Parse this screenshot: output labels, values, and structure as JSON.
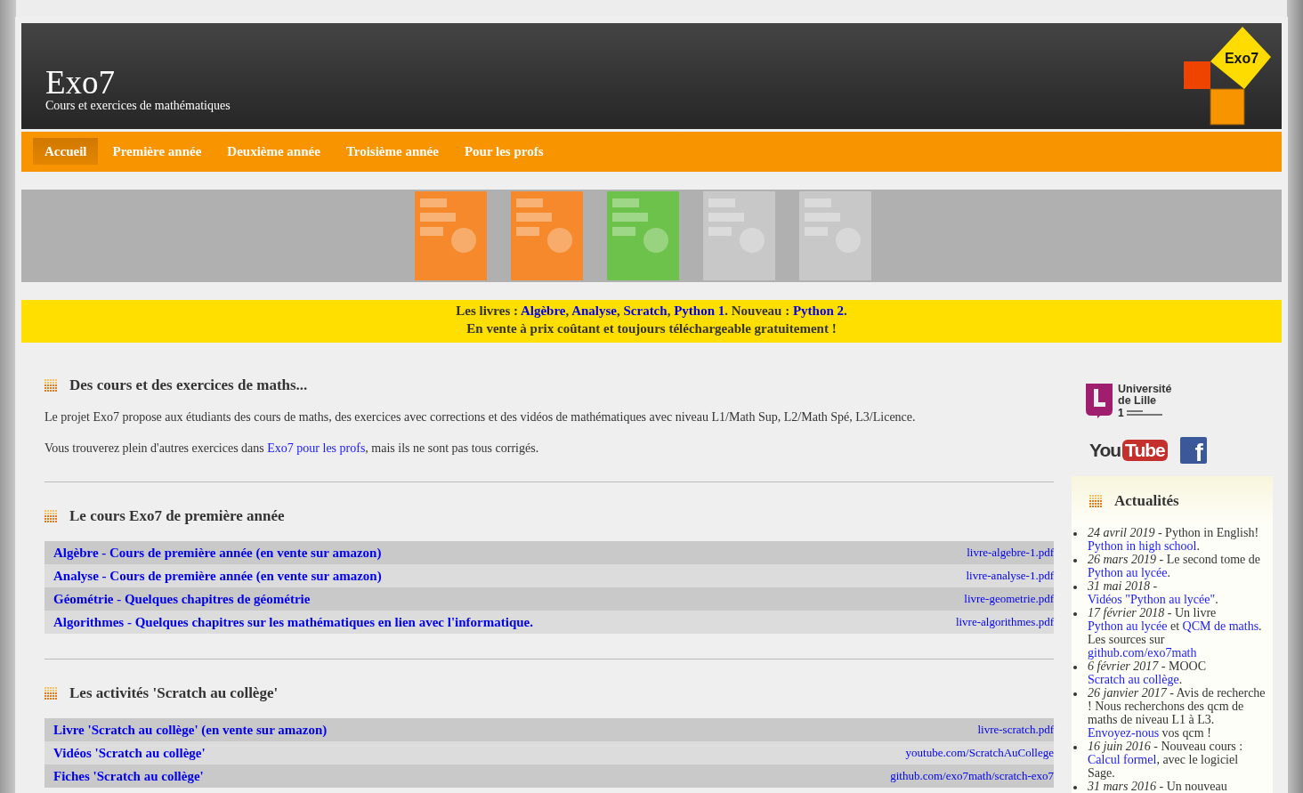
{
  "site": {
    "title": "Exo7",
    "subtitle": "Cours et exercices de mathématiques",
    "logo_text": "Exo7"
  },
  "nav": [
    {
      "label": "Accueil",
      "selected": true
    },
    {
      "label": "Première année",
      "selected": false
    },
    {
      "label": "Deuxième année",
      "selected": false
    },
    {
      "label": "Troisième année",
      "selected": false
    },
    {
      "label": "Pour les profs",
      "selected": false
    }
  ],
  "books": [
    {
      "color": "#f5892b"
    },
    {
      "color": "#f5892b"
    },
    {
      "color": "#6cc24a"
    },
    {
      "color": "#c8c8c8"
    },
    {
      "color": "#c8c8c8"
    }
  ],
  "banner": {
    "lines": [
      [
        {
          "text": "Les livres : ",
          "link": false
        },
        {
          "text": "Algèbre",
          "link": true
        },
        {
          "text": ", ",
          "link": false
        },
        {
          "text": "Analyse",
          "link": true
        },
        {
          "text": ", ",
          "link": false
        },
        {
          "text": "Scratch",
          "link": true
        },
        {
          "text": ", ",
          "link": false
        },
        {
          "text": "Python 1",
          "link": true
        },
        {
          "text": ". Nouveau : ",
          "link": false
        },
        {
          "text": "Python 2",
          "link": true
        },
        {
          "text": ".",
          "link": false
        }
      ],
      [
        {
          "text": "En vente à prix coûtant et toujours téléchargeable gratuitement !",
          "link": false
        }
      ]
    ]
  },
  "intro": {
    "heading": "Des cours et des exercices de maths...",
    "paragraphs": [
      [
        {
          "text": "Le projet Exo7 propose aux étudiants des cours de maths, des exercices avec corrections et des vidéos de mathématiques avec niveau L1/Math Sup, L2/Math Spé, L3/Licence.",
          "link": false
        }
      ],
      [
        {
          "text": "Vous trouverez plein d'autres exercices dans ",
          "link": false
        },
        {
          "text": "Exo7 pour les profs",
          "link": true
        },
        {
          "text": ", mais ils ne sont pas tous corrigés.",
          "link": false
        }
      ]
    ]
  },
  "sections": [
    {
      "heading": "Le cours Exo7 de première année",
      "rows": [
        {
          "title": "Algèbre - Cours de première année (en vente sur amazon)",
          "file": "livre-algebre-1.pdf"
        },
        {
          "title": "Analyse - Cours de première année (en vente sur amazon)",
          "file": "livre-analyse-1.pdf"
        },
        {
          "title": "Géométrie - Quelques chapitres de géométrie",
          "file": "livre-geometrie.pdf"
        },
        {
          "title": "Algorithmes - Quelques chapitres sur les mathématiques en lien avec l'informatique.",
          "file": "livre-algorithmes.pdf"
        }
      ]
    },
    {
      "heading": "Les activités 'Scratch au collège'",
      "rows": [
        {
          "title": "Livre 'Scratch au collège' (en vente sur amazon)",
          "file": "livre-scratch.pdf"
        },
        {
          "title": "Vidéos 'Scratch au collège'",
          "file": "youtube.com/ScratchAuCollege"
        },
        {
          "title": "Fiches 'Scratch au collège'",
          "file": "github.com/exo7math/scratch-exo7"
        }
      ]
    }
  ],
  "sidebar": {
    "university": {
      "name": "Université de Lille",
      "number": "1"
    },
    "youtube": {
      "you": "You",
      "tube": "Tube"
    },
    "facebook": {
      "letter": "f"
    },
    "news_title": "Actualités",
    "news": [
      {
        "date": "24 avril 2019",
        "parts": [
          {
            "text": " -  Python in English! ",
            "link": false
          },
          {
            "text": "Python in high school",
            "link": true
          },
          {
            "text": ".",
            "link": false
          }
        ]
      },
      {
        "date": "26 mars 2019",
        "parts": [
          {
            "text": " -  Le second tome de ",
            "link": false
          },
          {
            "text": "Python au lycée",
            "link": true
          },
          {
            "text": ".",
            "link": false
          }
        ]
      },
      {
        "date": "31 mai 2018",
        "parts": [
          {
            "text": " -  ",
            "link": false
          },
          {
            "text": "Vidéos \"Python au lycée\"",
            "link": true
          },
          {
            "text": ".",
            "link": false
          }
        ]
      },
      {
        "date": "17 février 2018",
        "parts": [
          {
            "text": " -  Un livre ",
            "link": false
          },
          {
            "text": "Python au lycée",
            "link": true
          },
          {
            "text": " et ",
            "link": false
          },
          {
            "text": "QCM de maths",
            "link": true
          },
          {
            "text": ". Les sources sur ",
            "link": false
          },
          {
            "text": "github.com/exo7math",
            "link": true
          }
        ]
      },
      {
        "date": "6 février 2017",
        "parts": [
          {
            "text": " -  MOOC ",
            "link": false
          },
          {
            "text": "Scratch au collège",
            "link": true
          },
          {
            "text": ".",
            "link": false
          }
        ]
      },
      {
        "date": "26 janvier 2017",
        "parts": [
          {
            "text": " -  Avis de recherche ! Nous recherchons des qcm de maths de niveau L1 à L3. ",
            "link": false
          },
          {
            "text": "Envoyez-nous",
            "link": true
          },
          {
            "text": " vos qcm !",
            "link": false
          }
        ]
      },
      {
        "date": "16 juin 2016",
        "parts": [
          {
            "text": " -  Nouveau cours : ",
            "link": false
          },
          {
            "text": "Calcul formel",
            "link": true
          },
          {
            "text": ", avec le logiciel Sage.",
            "link": false
          }
        ]
      },
      {
        "date": "31 mars 2016",
        "parts": [
          {
            "text": " -  Un nouveau",
            "link": false
          }
        ]
      }
    ]
  }
}
